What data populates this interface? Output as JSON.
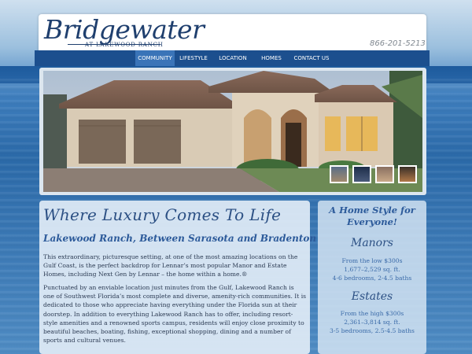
{
  "brand": {
    "logo_main": "Bridgewater",
    "logo_sub": "AT LAKEWOOD RANCH",
    "phone": "866-201-5213"
  },
  "nav": {
    "items": [
      {
        "label": "COMMUNITY",
        "active": true
      },
      {
        "label": "LIFESTYLE",
        "active": false
      },
      {
        "label": "LOCATION",
        "active": false
      },
      {
        "label": "HOMES",
        "active": false
      },
      {
        "label": "CONTACT US",
        "active": false
      }
    ]
  },
  "hero": {
    "thumbnails": 4
  },
  "main": {
    "title": "Where Luxury Comes To Life",
    "subtitle": "Lakewood Ranch, Between Sarasota and Bradenton",
    "paragraph1": "This extraordinary, picturesque setting, at one of the most amazing locations on the Gulf Coast, is the perfect backdrop for Lennar’s most popular Manor and Estate Homes, including Next Gen by Lennar – the home within a home.®",
    "paragraph2": "Punctuated by an enviable location just minutes from the Gulf, Lakewood Ranch is one of Southwest Florida’s most complete and diverse, amenity-rich communities. It is dedicated to those who appreciate having everything under the Florida sun at their doorstep. In addition to everything Lakewood Ranch has to offer, including resort-style amenities and a renowned sports campus, residents will enjoy close proximity to beautiful beaches, boating, fishing, exceptional shopping, dining and a number of sports and cultural venues."
  },
  "sidebar": {
    "title": "A Home Style for Everyone!",
    "manors": {
      "heading": "Manors",
      "price": "From the low $300s",
      "sqft": "1,677–2,529 sq. ft.",
      "rooms": "4-6 bedrooms, 2-4.5 baths"
    },
    "estates": {
      "heading": "Estates",
      "price": "From the high $300s",
      "sqft": "2,361–3,814 sq. ft.",
      "rooms": "3-5 bedrooms, 2.5-4.5 baths"
    }
  },
  "colors": {
    "brand_navy": "#1f3f6e",
    "nav_bg": "#1c4f8e",
    "nav_active": "#3a74b8",
    "accent_blue": "#2c5a9a"
  }
}
